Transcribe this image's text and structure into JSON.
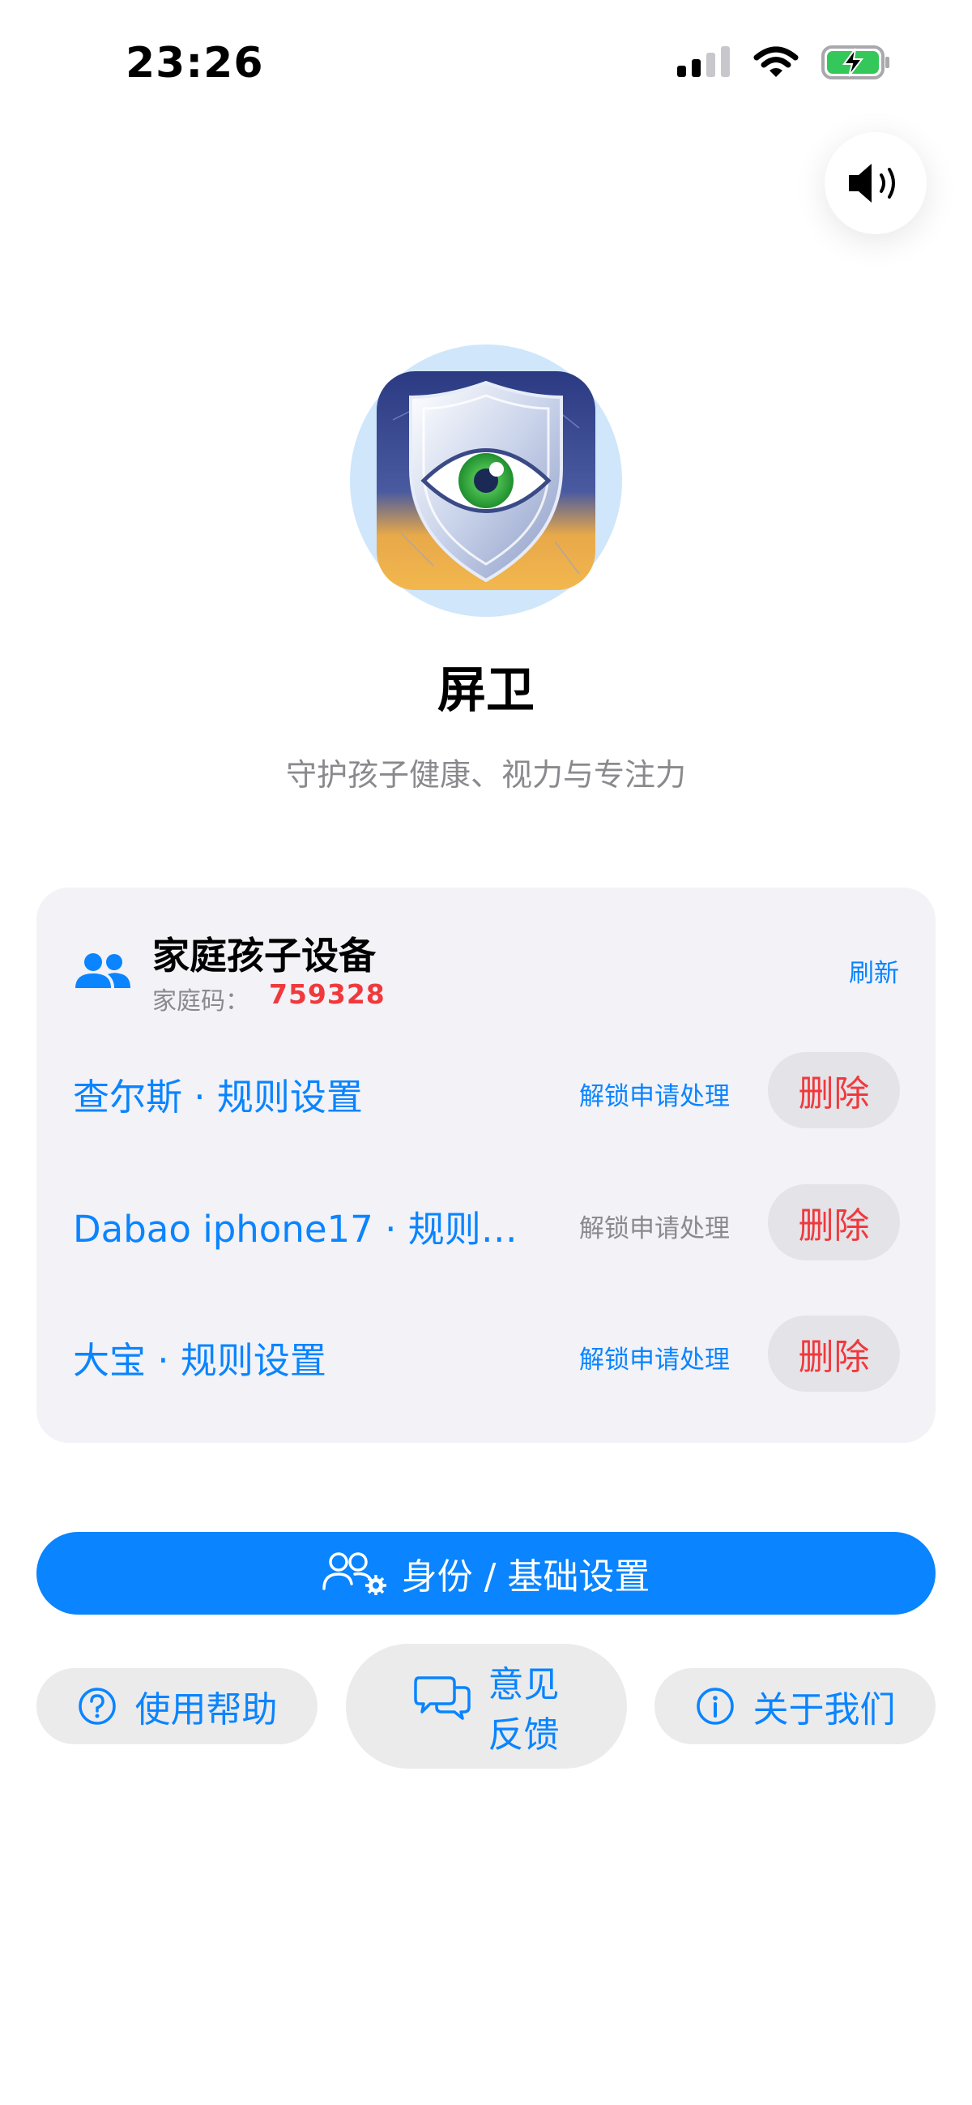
{
  "status_bar": {
    "time": "23:26"
  },
  "app": {
    "name": "屏卫",
    "tagline": "守护孩子健康、视力与专注力"
  },
  "family": {
    "title": "家庭孩子设备",
    "code_label": "家庭码：",
    "code": "759328",
    "refresh_label": "刷新",
    "devices": [
      {
        "name": "查尔斯 · 规则设置",
        "unlock_label": "解锁申请处理",
        "delete_label": "删除"
      },
      {
        "name": "Dabao iphone17 · 规则…",
        "unlock_label": "解锁申请处理",
        "delete_label": "删除"
      },
      {
        "name": "大宝 · 规则设置",
        "unlock_label": "解锁申请处理",
        "delete_label": "删除"
      }
    ]
  },
  "actions": {
    "identity_label": "身份 / 基础设置",
    "help_label": "使用帮助",
    "feedback_line1": "意见",
    "feedback_line2": "反馈",
    "about_label": "关于我们"
  },
  "colors": {
    "accent": "#0a84ff",
    "danger": "#f0393c",
    "card_bg": "#f2f2f7",
    "pill_bg": "#ebebeb"
  },
  "icons": [
    "signal-icon",
    "wifi-icon",
    "battery-charging-icon",
    "speaker-icon",
    "shield-eye-logo",
    "family-users-icon",
    "user-settings-icon",
    "help-icon",
    "chat-bubbles-icon",
    "info-icon"
  ]
}
